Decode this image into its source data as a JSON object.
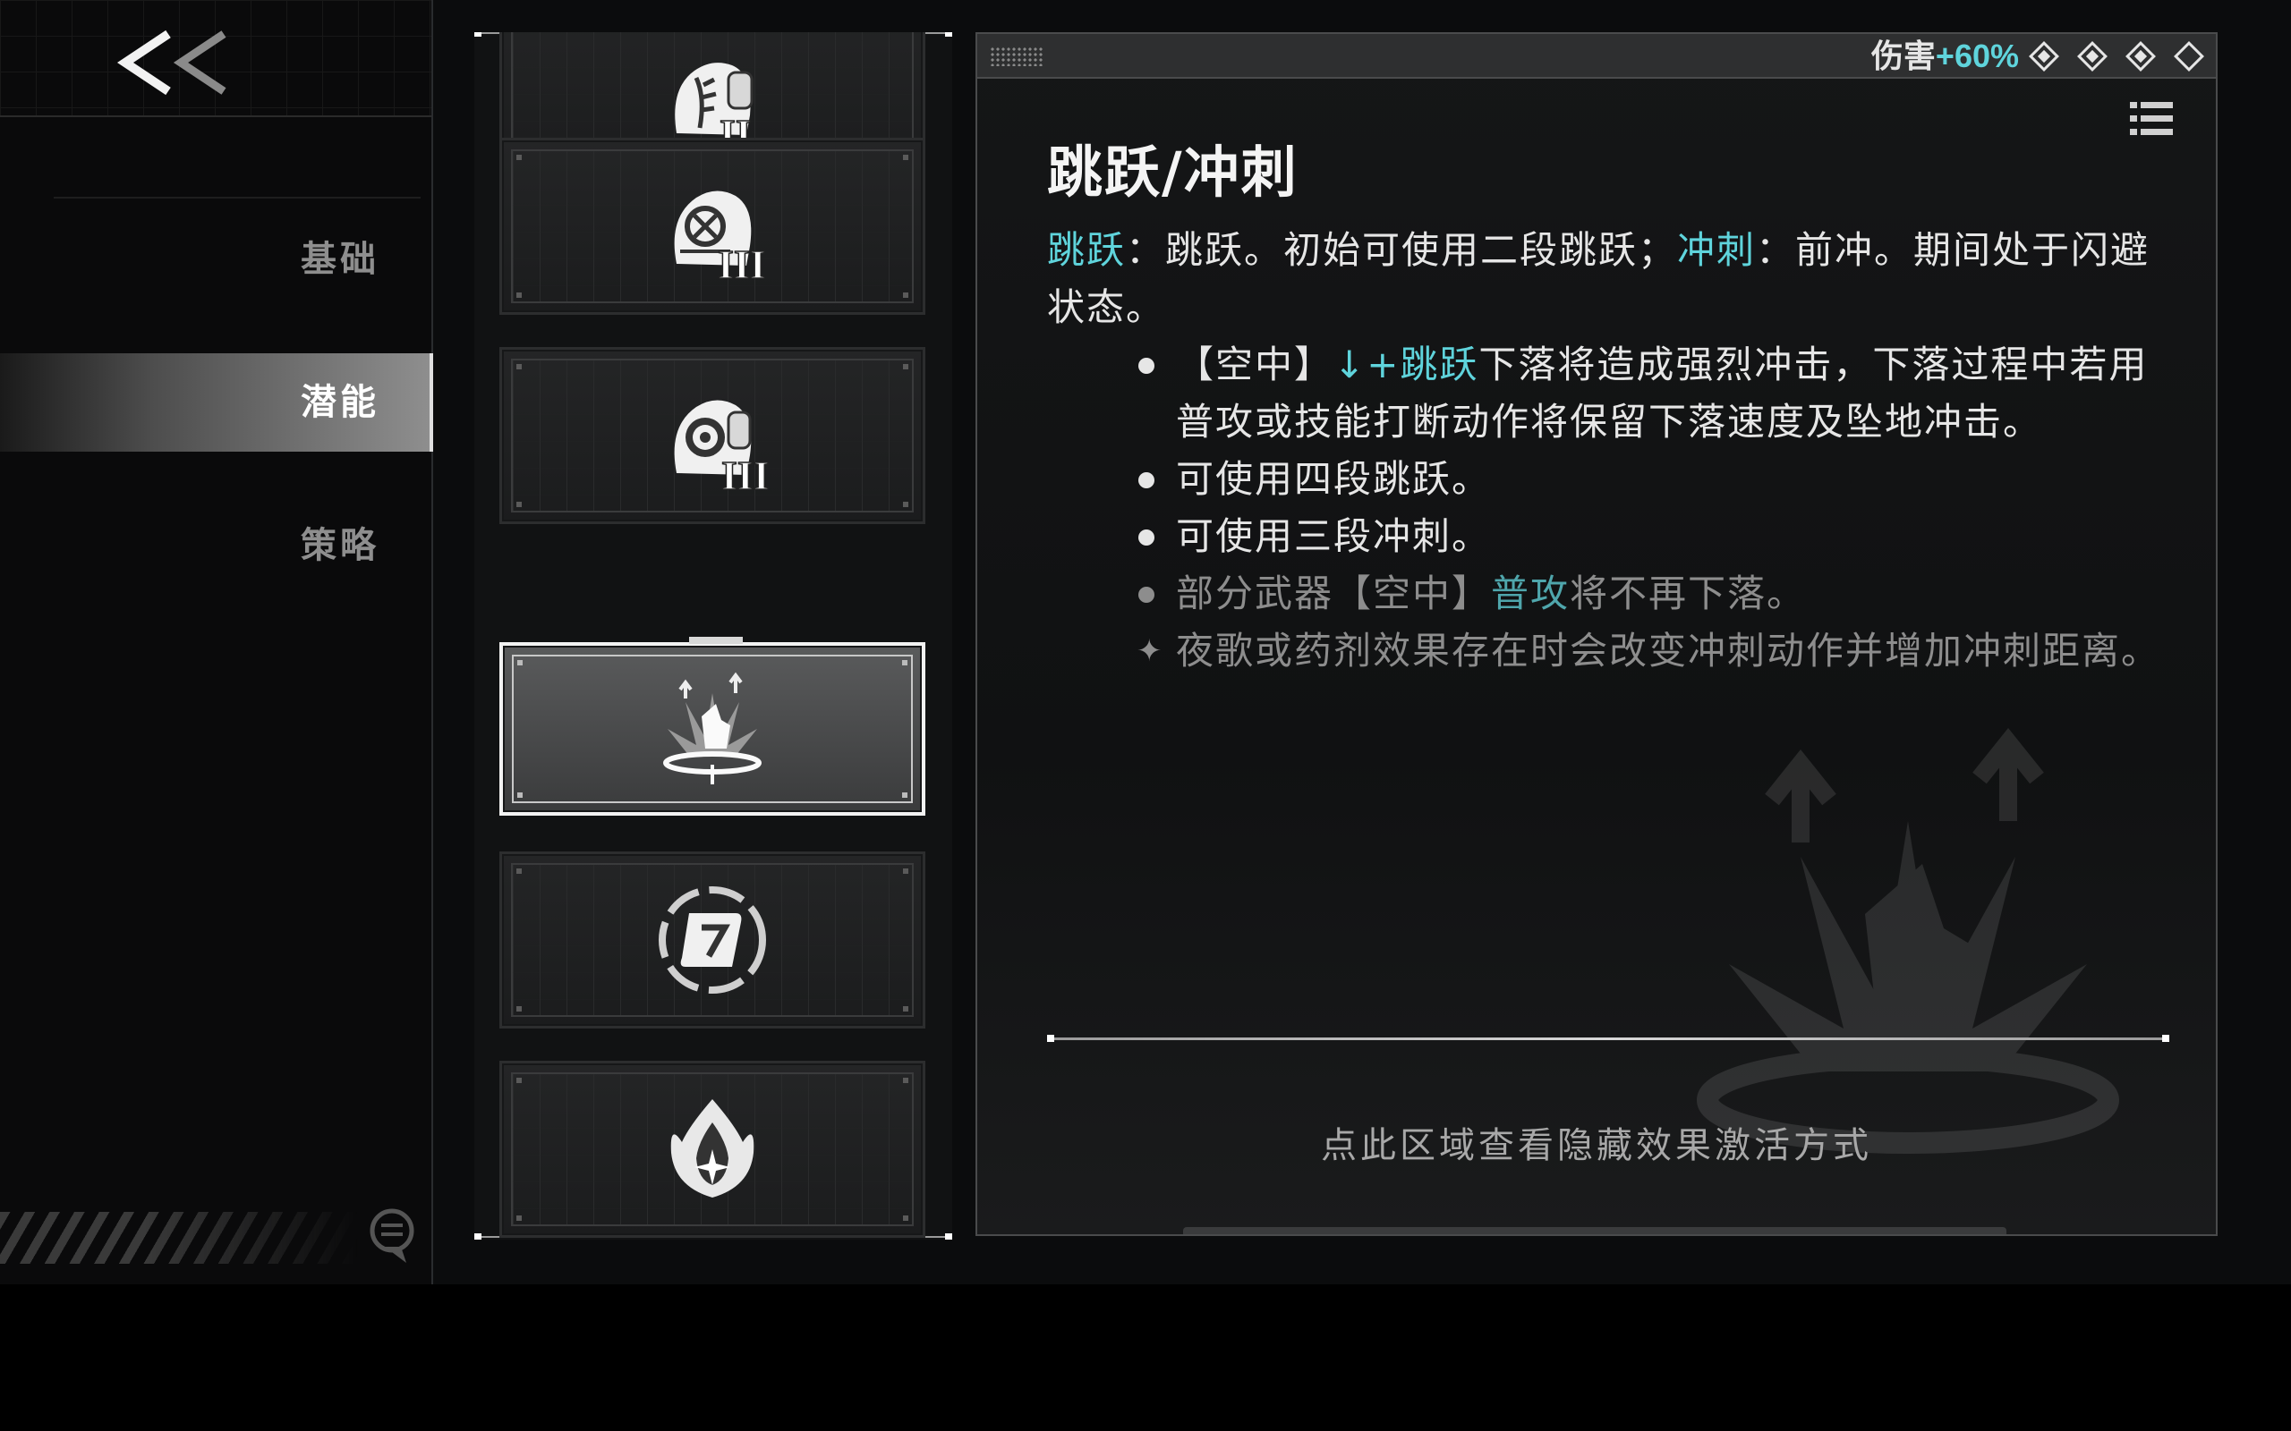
{
  "sidebar": {
    "back_icon": "double-chevron-left-icon",
    "items": [
      {
        "label": "基础",
        "active": false
      },
      {
        "label": "潜能",
        "active": true
      },
      {
        "label": "策略",
        "active": false
      }
    ],
    "chat_icon": "chat-bubble-icon"
  },
  "potential_cards": [
    {
      "icon": "backpack-feather-icon",
      "rank": "II",
      "active": false
    },
    {
      "icon": "backpack-compass-icon",
      "rank": "III",
      "active": false
    },
    {
      "icon": "backpack-gear-icon",
      "rank": "III",
      "active": false
    },
    {
      "icon": "jump-dash-icon",
      "rank": "",
      "active": true
    },
    {
      "icon": "scroll-icon",
      "rank": "",
      "active": false
    },
    {
      "icon": "flame-star-icon",
      "rank": "",
      "active": false
    }
  ],
  "detail": {
    "header": {
      "damage_label": "伤害",
      "damage_value": "+60%",
      "levels": [
        true,
        true,
        true,
        false
      ]
    },
    "title": "跳跃/冲刺",
    "intro": {
      "kw1": "跳跃",
      "text1": "：跳跃。初始可使用二段跳跃；",
      "kw2": "冲刺",
      "text2": "：前冲。期间处于闪避状态。"
    },
    "bullets": {
      "b1_pre": "【空中】",
      "b1_kw": "↓+跳跃",
      "b1_post": "下落将造成强烈冲击，下落过程中若用普攻或技能打断动作将保留下落速度及坠地冲击。",
      "b2": "可使用四段跳跃。",
      "b3": "可使用三段冲刺。",
      "b4_pre": "部分武器【空中】",
      "b4_kw": "普攻",
      "b4_post": "将不再下落。",
      "b5": "夜歌或药剂效果存在时会改变冲刺动作并增加冲刺距离。"
    },
    "hint": "点此区域查看隐藏效果激活方式"
  }
}
